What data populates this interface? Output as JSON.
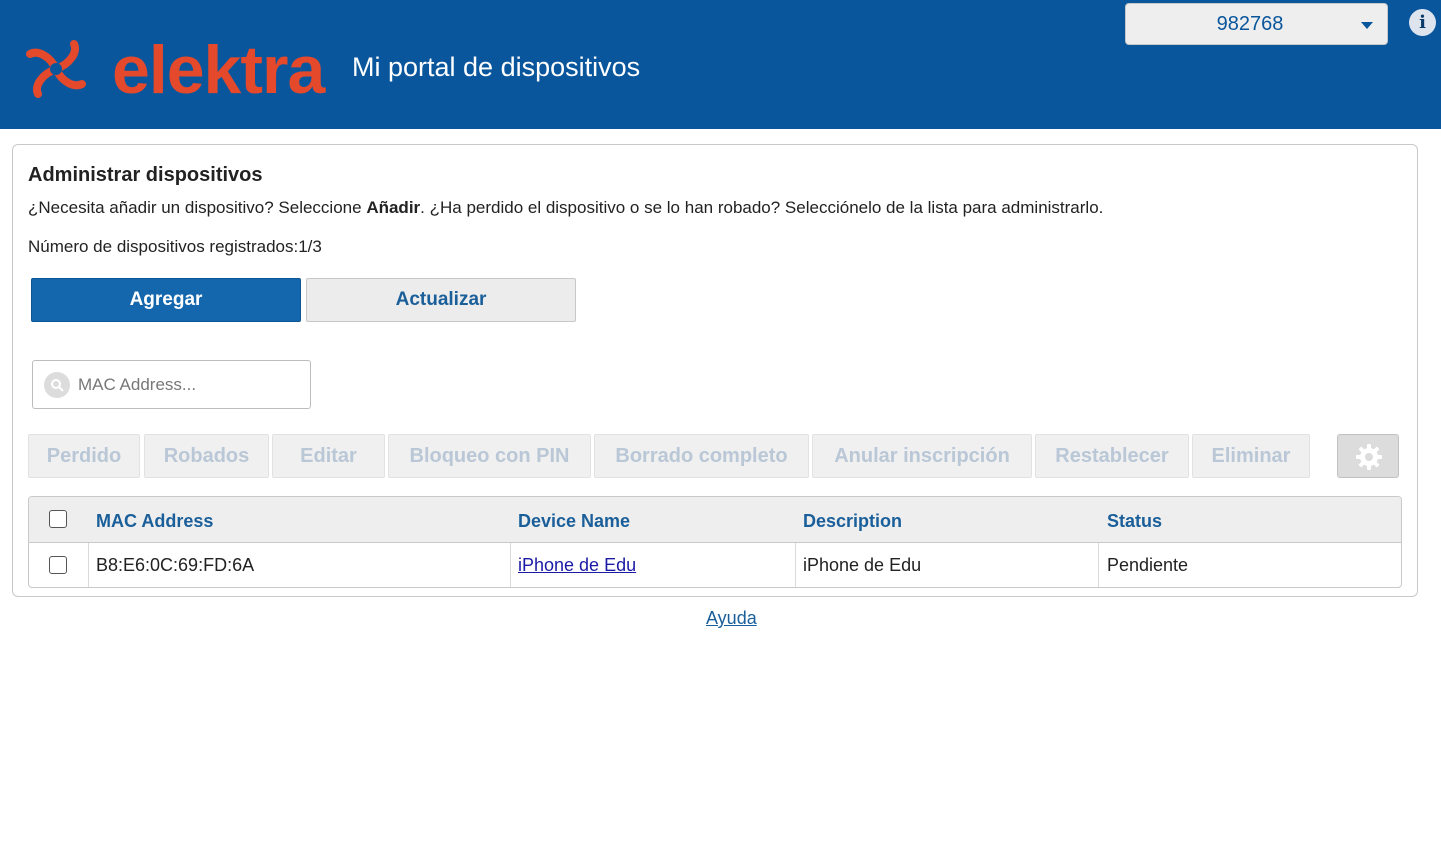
{
  "header": {
    "logo_text": "elektra",
    "title": "Mi portal de dispositivos",
    "account_selected": "982768",
    "info_icon": "info-icon",
    "brand_color": "#0a569c",
    "logo_color": "#e4492c"
  },
  "main": {
    "title": "Administrar dispositivos",
    "description_before": "¿Necesita añadir un dispositivo? Seleccione ",
    "description_bold": "Añadir",
    "description_after": ". ¿Ha perdido el dispositivo o se lo han robado? Selecciónelo de la lista para administrarlo.",
    "device_count": "Número de dispositivos registrados:1/3",
    "add_button": "Agregar",
    "refresh_button": "Actualizar",
    "search": {
      "placeholder": "MAC Address..."
    },
    "actions": [
      "Perdido",
      "Robados",
      "Editar",
      "Bloqueo con PIN",
      "Borrado completo",
      "Anular inscripción",
      "Restablecer",
      "Eliminar"
    ],
    "settings_icon": "gear-icon"
  },
  "table": {
    "columns": [
      "MAC Address",
      "Device Name",
      "Description",
      "Status"
    ],
    "rows": [
      {
        "mac": "B8:E6:0C:69:FD:6A",
        "device_name": "iPhone de Edu",
        "description": "iPhone de Edu",
        "status": "Pendiente"
      }
    ]
  },
  "footer": {
    "help_link": "Ayuda"
  }
}
